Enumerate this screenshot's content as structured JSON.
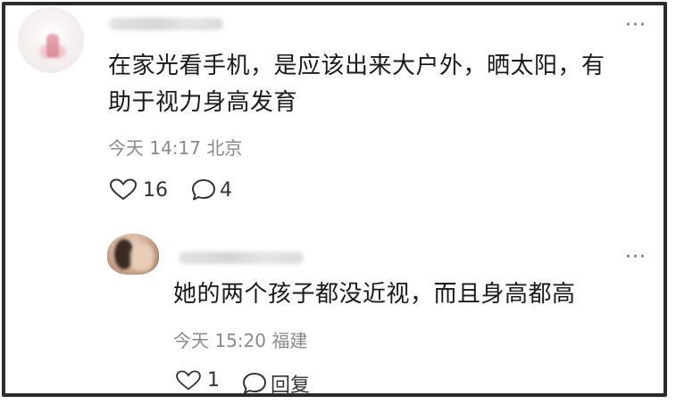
{
  "comment": {
    "text_line1": "在家光看手机，是应该出来大户外，晒太阳，有",
    "text_line2": "助于视力身高发育",
    "time": "今天 14:17",
    "location": "北京",
    "like_count": "16",
    "reply_count": "4",
    "more_label": "···"
  },
  "reply": {
    "text": "她的两个孩子都没近视，而且身高都高",
    "time": "今天 15:20",
    "location": "福建",
    "like_count": "1",
    "reply_label": "回复",
    "more_label": "···"
  },
  "icons": {
    "like": "heart-outline-icon",
    "comment": "speech-bubble-icon",
    "more": "more-horizontal-icon"
  },
  "colors": {
    "text": "#1a1a1a",
    "meta": "#8a8a8a",
    "border": "#2b2b2b"
  }
}
